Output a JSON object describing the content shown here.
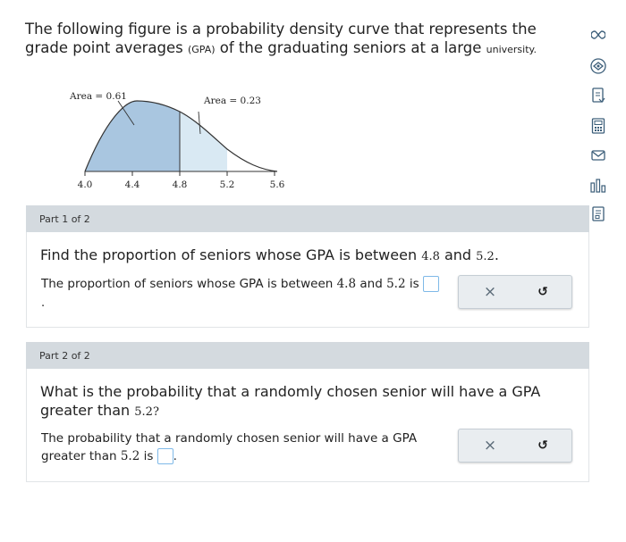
{
  "intro": {
    "text_a": "The following figure is a probability density curve that represents the grade point averages ",
    "gpa_abbr": "(GPA)",
    "text_b": " of the graduating seniors at a large ",
    "university": "university."
  },
  "figure": {
    "left_area_label": "Area = 0.61",
    "right_area_label": "Area = 0.23",
    "ticks": [
      "4.0",
      "4.4",
      "4.8",
      "5.2",
      "5.6"
    ],
    "left_fill_color": "#a9c6e0",
    "right_fill_color": "#d9e9f3"
  },
  "sidebar": {
    "icons": [
      "infinity-icon",
      "eye-icon",
      "file-icon",
      "calculator-icon",
      "mail-icon",
      "bar-chart-icon",
      "document-icon"
    ]
  },
  "part1": {
    "header": "Part 1 of 2",
    "question_a": "Find the proportion of seniors whose GPA is between ",
    "val1": "4.8",
    "question_and": " and ",
    "val2": "5.2",
    "question_end": ".",
    "prompt_a": "The proportion of seniors whose GPA is between ",
    "prompt_and": " and ",
    "prompt_is": " is ",
    "trailing_dot": "."
  },
  "part2": {
    "header": "Part 2 of 2",
    "question_a": "What is the probability that a randomly chosen senior will have a GPA greater than ",
    "val": "5.2?",
    "prompt_a": "The probability that a randomly chosen senior will have a GPA greater than ",
    "prompt_val": "5.2",
    "prompt_is": " is ",
    "trailing_dot": "."
  },
  "actions": {
    "clear_symbol": "×",
    "undo_symbol": "↺"
  },
  "colors": {
    "action_clear": "#5b6b78",
    "action_undo": "#1a1a1a",
    "input_border": "#7fb9e8"
  }
}
